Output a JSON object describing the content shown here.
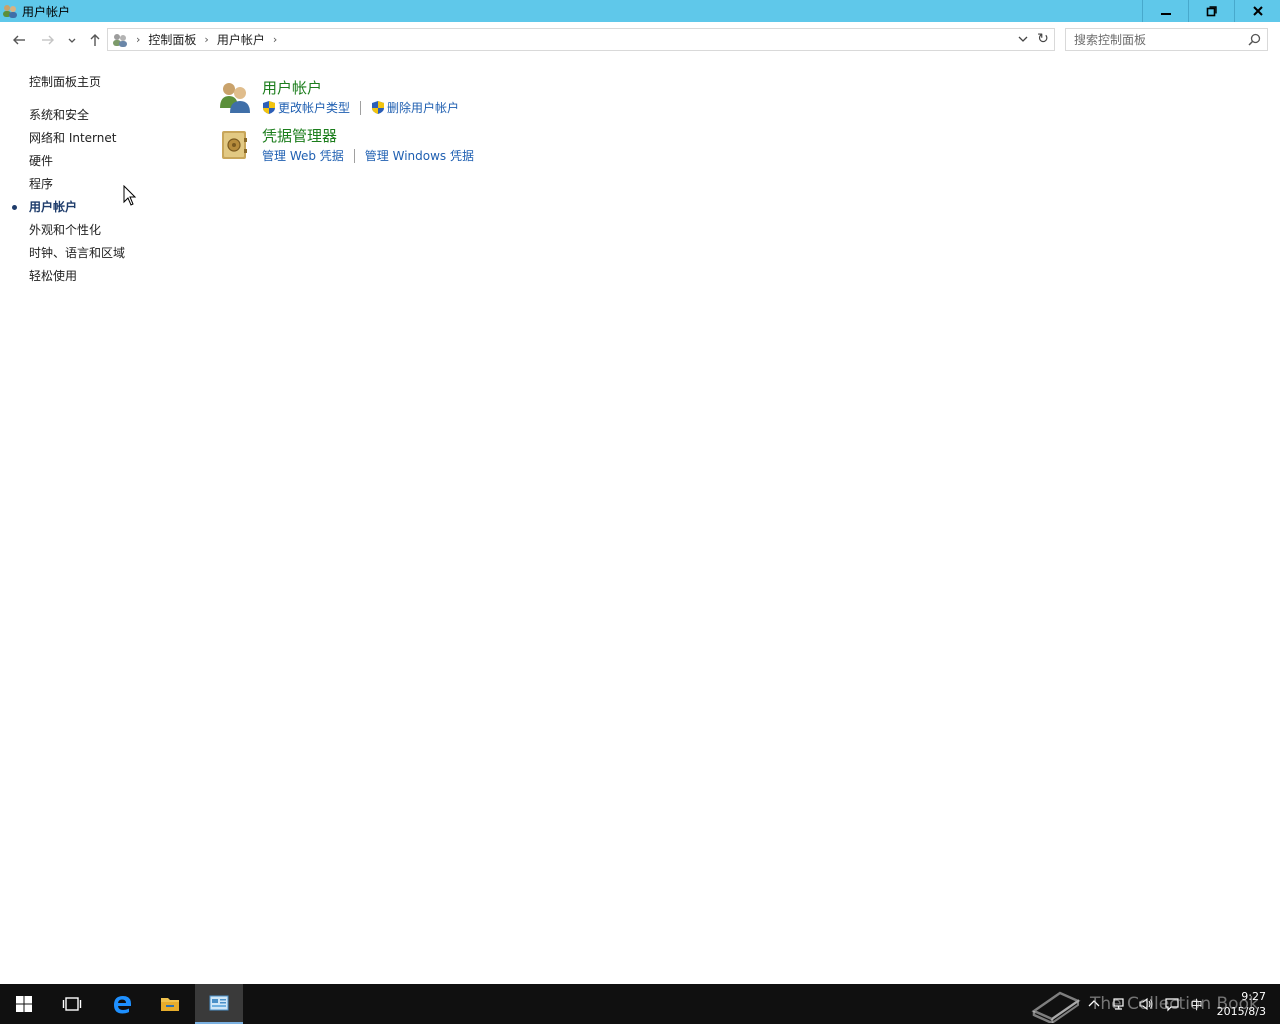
{
  "window": {
    "title": "用户帐户"
  },
  "address_bar": {
    "crumbs": [
      "控制面板",
      "用户帐户"
    ]
  },
  "search": {
    "placeholder": "搜索控制面板"
  },
  "sidebar": {
    "home": "控制面板主页",
    "items": [
      {
        "label": "系统和安全"
      },
      {
        "label": "网络和 Internet"
      },
      {
        "label": "硬件"
      },
      {
        "label": "程序"
      },
      {
        "label": "用户帐户",
        "active": true
      },
      {
        "label": "外观和个性化"
      },
      {
        "label": "时钟、语言和区域"
      },
      {
        "label": "轻松使用"
      }
    ]
  },
  "categories": [
    {
      "title": "用户帐户",
      "icon": "users-icon",
      "links": [
        {
          "label": "更改帐户类型",
          "shield": true
        },
        {
          "label": "删除用户帐户",
          "shield": true
        }
      ]
    },
    {
      "title": "凭据管理器",
      "icon": "vault-icon",
      "links": [
        {
          "label": "管理 Web 凭据",
          "shield": false
        },
        {
          "label": "管理 Windows 凭据",
          "shield": false
        }
      ]
    }
  ],
  "taskbar": {
    "ime": "中",
    "time": "9:27",
    "date": "2015/8/3"
  },
  "watermark": {
    "text": "The Collection Book"
  },
  "colors": {
    "titlebar": "#5fc8ea",
    "category_title": "#1b7d1b",
    "link": "#1f5fb1",
    "taskbar": "#101010"
  }
}
